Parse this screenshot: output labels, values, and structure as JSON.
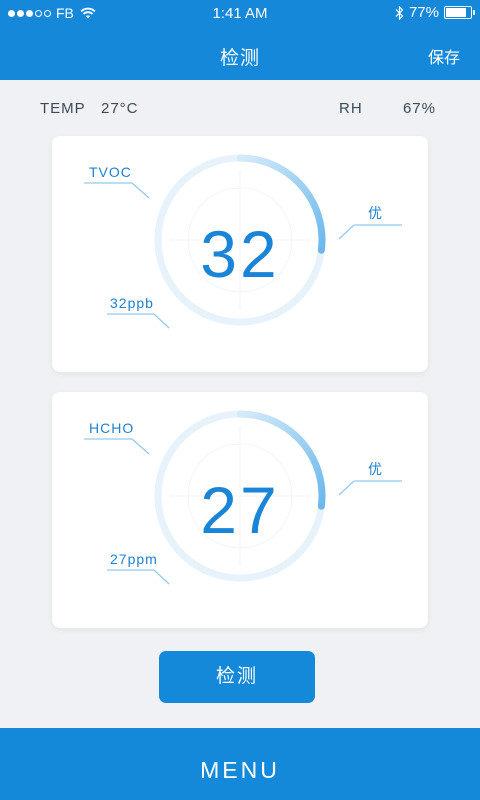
{
  "status_bar": {
    "carrier": "FB",
    "time": "1:41 AM",
    "battery_percent": "77%",
    "battery_level": 0.77
  },
  "nav": {
    "title": "检测",
    "save_label": "保存"
  },
  "environment": {
    "temp_label": "TEMP",
    "temp_value": "27°C",
    "rh_label": "RH",
    "rh_value": "67%"
  },
  "cards": [
    {
      "name": "TVOC",
      "value": "32",
      "reading": "32ppb",
      "grade": "优",
      "progress": 0.27
    },
    {
      "name": "HCHO",
      "value": "27",
      "reading": "27ppm",
      "grade": "优",
      "progress": 0.27
    }
  ],
  "detect_button_label": "检测",
  "menu_label": "MENU",
  "colors": {
    "primary": "#1589d9",
    "accent_text": "#1e82cf",
    "background": "#eff1f4"
  }
}
